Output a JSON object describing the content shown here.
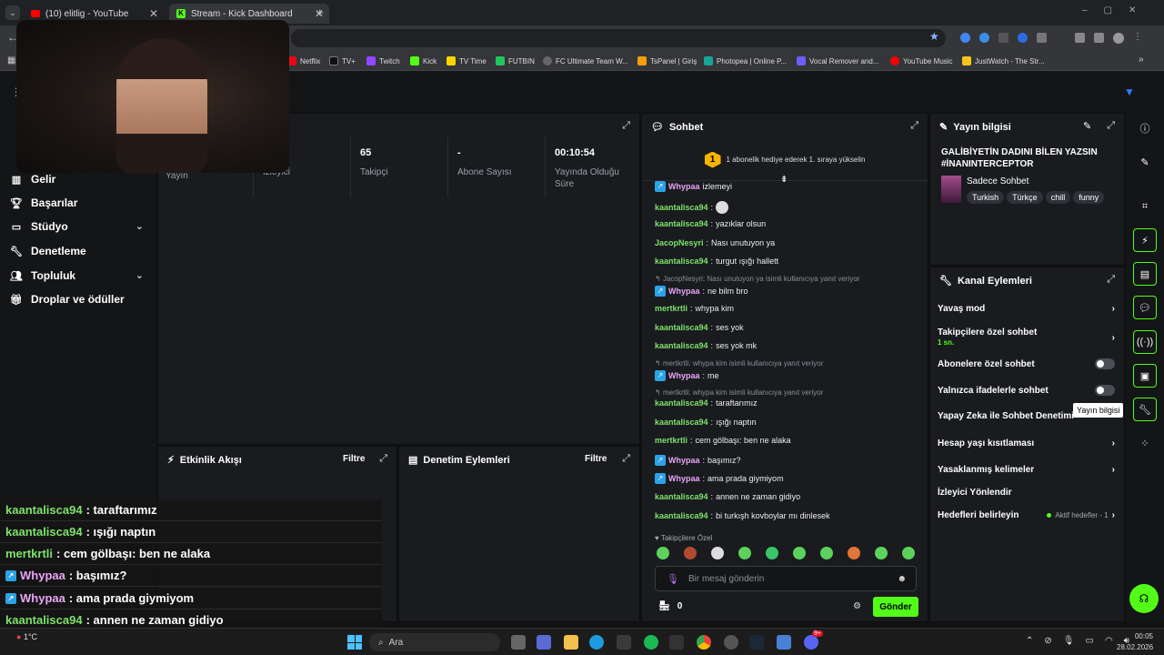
{
  "browser": {
    "tabs": [
      {
        "label": "(10) elitlig - YouTube"
      },
      {
        "label": "Stream - Kick Dashboard"
      }
    ],
    "new_tab": "+",
    "bookmarks": [
      "Netflix",
      "TV+",
      "Twitch",
      "Kick",
      "TV Time",
      "FUTBIN",
      "FC Ultimate Team W...",
      "TsPanel | Giriş",
      "Photopea | Online P...",
      "Vocal Remover and...",
      "YouTube Music",
      "JustWatch - The Str..."
    ]
  },
  "sidebar": {
    "items": [
      {
        "label": "Gelir",
        "icon": "chart-icon"
      },
      {
        "label": "Başarılar",
        "icon": "trophy-icon"
      },
      {
        "label": "Stüdyo",
        "icon": "studio-icon",
        "expandable": true
      },
      {
        "label": "Denetleme",
        "icon": "wrench-icon"
      },
      {
        "label": "Topluluk",
        "icon": "community-icon",
        "expandable": true
      },
      {
        "label": "Droplar ve ödüller",
        "icon": "gift-icon"
      }
    ]
  },
  "stats": {
    "items": [
      {
        "label": "Yayın",
        "value": ""
      },
      {
        "label": "İzleyici",
        "value": ""
      },
      {
        "label": "Takipçi",
        "value": "65"
      },
      {
        "label": "Abone Sayısı",
        "value": "-"
      },
      {
        "label": "Yayında Olduğu Süre",
        "value": "00:10:54"
      }
    ]
  },
  "activity": {
    "title": "Etkinlik Akışı",
    "filter": "Filtre"
  },
  "moderation": {
    "title": "Denetim Eylemleri",
    "filter": "Filtre"
  },
  "chat": {
    "title": "Sohbet",
    "promo_number": "1",
    "promo_text": "1 abonelik hediye ederek 1. sıraya yükselin",
    "partial_top": {
      "user": "Whypaa",
      "text": "izlemeyi"
    },
    "messages": [
      {
        "type": "msg",
        "user": "kaantalisca94",
        "color": "green",
        "text": ""
      },
      {
        "type": "msg",
        "user": "kaantalisca94",
        "color": "green",
        "text": "yazıklar olsun"
      },
      {
        "type": "msg",
        "user": "JacopNesyri",
        "color": "green",
        "text": "Nası unutuyon ya"
      },
      {
        "type": "msg",
        "user": "kaantalisca94",
        "color": "green",
        "text": "turgut ışığı hallett"
      },
      {
        "type": "reply",
        "text": "JacopNesyri: Nası unutuyon ya isimli kullanıcıya yanıt veriyor"
      },
      {
        "type": "msg",
        "user": "Whypaa",
        "color": "pink",
        "badge": true,
        "text": "ne bilm bro"
      },
      {
        "type": "msg",
        "user": "mertkrtli",
        "color": "green",
        "text": "whypa kim"
      },
      {
        "type": "msg",
        "user": "kaantalisca94",
        "color": "green",
        "text": "ses yok"
      },
      {
        "type": "msg",
        "user": "kaantalisca94",
        "color": "green",
        "text": "ses yok mk"
      },
      {
        "type": "reply",
        "text": "mertkrtli: whypa kim isimli kullanıcıya yanıt veriyor"
      },
      {
        "type": "msg",
        "user": "Whypaa",
        "color": "pink",
        "badge": true,
        "text": "me"
      },
      {
        "type": "reply",
        "text": "mertkrtli: whypa kim isimli kullanıcıya yanıt veriyor"
      },
      {
        "type": "msg",
        "user": "kaantalisca94",
        "color": "green",
        "text": "taraftarımız"
      },
      {
        "type": "msg",
        "user": "kaantalisca94",
        "color": "green",
        "text": "ışığı naptın"
      },
      {
        "type": "msg",
        "user": "mertkrtli",
        "color": "green",
        "text": "cem gölbaşı: ben ne alaka"
      },
      {
        "type": "msg",
        "user": "Whypaa",
        "color": "pink",
        "badge": true,
        "text": "başımız?"
      },
      {
        "type": "msg",
        "user": "Whypaa",
        "color": "pink",
        "badge": true,
        "text": "ama prada giymiyom"
      },
      {
        "type": "msg",
        "user": "kaantalisca94",
        "color": "green",
        "text": "annen ne zaman gidiyo"
      },
      {
        "type": "msg",
        "user": "kaantalisca94",
        "color": "green",
        "text": "bi turkışh kovboylar mı dinlesek"
      }
    ],
    "emote_section_label": "Takipçilere Özel",
    "input_placeholder": "Bir mesaj gönderin",
    "points": "0",
    "send_label": "Gönder"
  },
  "stream_info": {
    "title": "Yayın bilgisi",
    "stream_title": "GALİBİYETİN DADINI BİLEN YAZSIN #İNANINTERCEPTOR",
    "category": "Sadece Sohbet",
    "tags": [
      "Turkish",
      "Türkçe",
      "chill",
      "funny"
    ]
  },
  "channel_actions": {
    "title": "Kanal Eylemleri",
    "rows": [
      {
        "label": "Yavaş mod",
        "control": "chevron"
      },
      {
        "label": "Takipçilere özel sohbet",
        "sub": "1 sn.",
        "control": "chevron"
      },
      {
        "label": "Abonelere özel sohbet",
        "control": "toggle"
      },
      {
        "label": "Yalnızca ifadelerle sohbet",
        "control": "toggle"
      },
      {
        "label": "Yapay Zeka ile Sohbet Denetimi",
        "control": "none"
      },
      {
        "label": "Hesap yaşı kısıtlaması",
        "control": "chevron"
      },
      {
        "label": "Yasaklanmış kelimeler",
        "control": "chevron"
      },
      {
        "label": "İzleyici Yönlendir",
        "control": "none"
      },
      {
        "label": "Hedefleri belirleyin",
        "status": "Aktif hedefler - 1",
        "control": "chevron"
      }
    ]
  },
  "tooltip": "Yayın bilgisi",
  "overlay_chat": [
    {
      "user": "kaantalisca94",
      "text": ": taraftarımız",
      "color": "green"
    },
    {
      "user": "kaantalisca94",
      "text": ": ışığı naptın",
      "color": "green"
    },
    {
      "user": "mertkrtli",
      "text": ": cem gölbaşı: ben ne alaka",
      "color": "green"
    },
    {
      "user": "Whypaa",
      "text": ": başımız?",
      "color": "pink",
      "badge": true
    },
    {
      "user": "Whypaa",
      "text": ": ama prada giymiyom",
      "color": "pink",
      "badge": true
    },
    {
      "user": "kaantalisca94",
      "text": ": annen ne zaman gidiyo",
      "color": "green"
    },
    {
      "user": "kaantalisca94",
      "text": ": bi turkışh kovboylar mı dinlesek",
      "color": "green"
    }
  ],
  "taskbar": {
    "search_label": "Ara",
    "weather": "1°C",
    "time": "00:05",
    "date": "28.02.2026",
    "discord_badge": "9+"
  },
  "colors": {
    "kick_green": "#53fc18",
    "username_green": "#7ee26b",
    "username_pink": "#e8a6f5"
  }
}
